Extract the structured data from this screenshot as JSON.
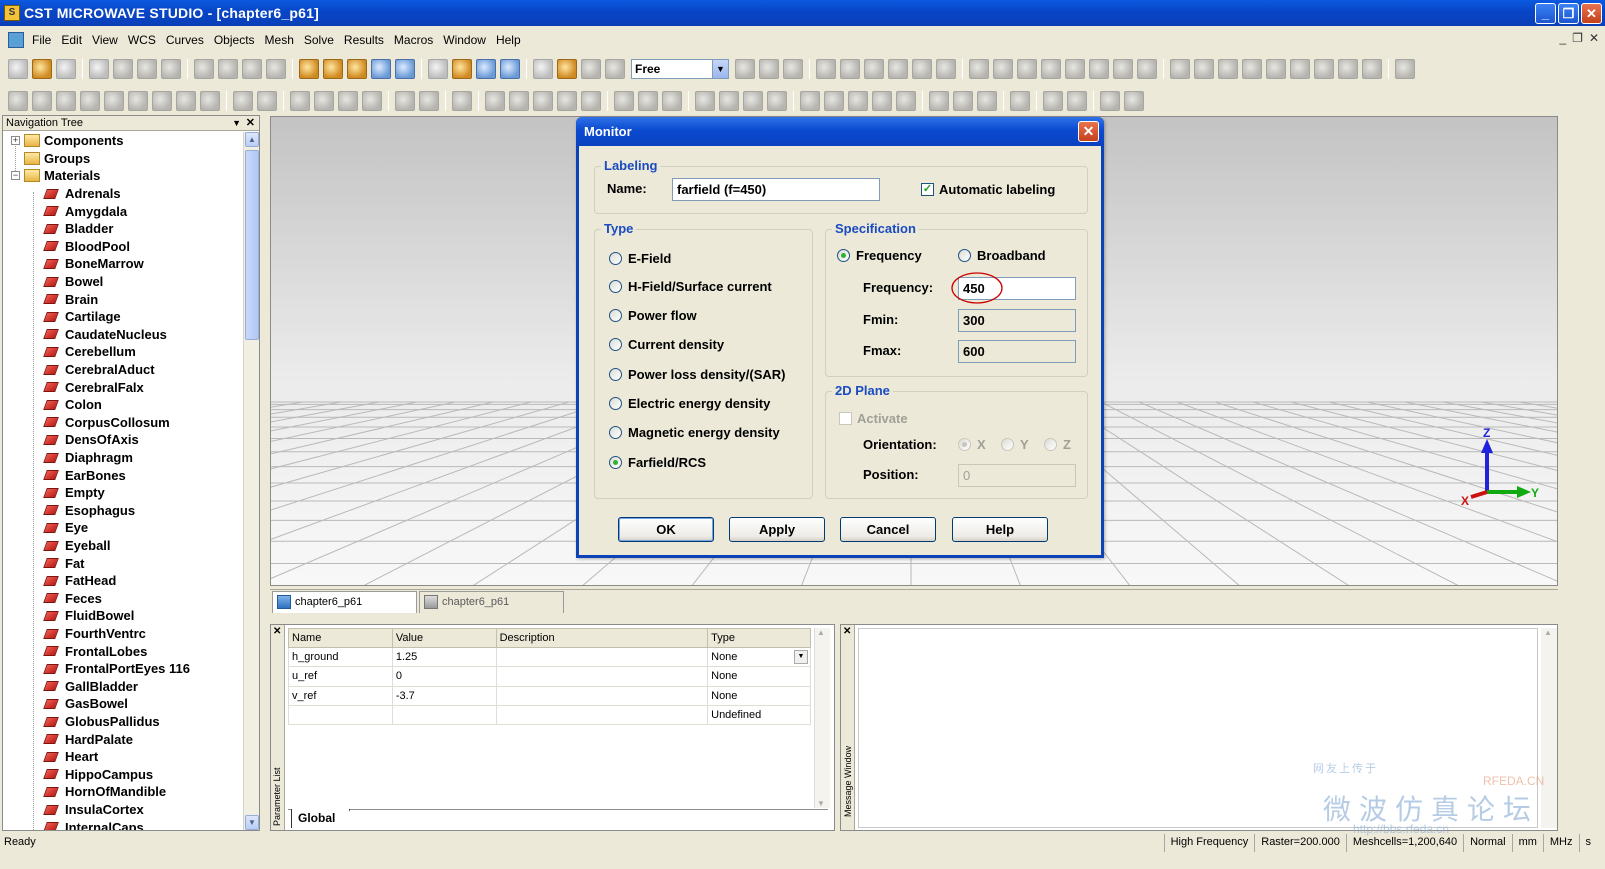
{
  "window": {
    "title": "CST MICROWAVE STUDIO - [chapter6_p61]",
    "min": "_",
    "max": "❐",
    "close": "✕"
  },
  "menu": [
    "File",
    "Edit",
    "View",
    "WCS",
    "Curves",
    "Objects",
    "Mesh",
    "Solve",
    "Results",
    "Macros",
    "Window",
    "Help"
  ],
  "toolbar": {
    "view_mode": "Free"
  },
  "navigation": {
    "title": "Navigation Tree",
    "folders": [
      "Components",
      "Groups",
      "Materials"
    ],
    "materials": [
      "Adrenals",
      "Amygdala",
      "Bladder",
      "BloodPool",
      "BoneMarrow",
      "Bowel",
      "Brain",
      "Cartilage",
      "CaudateNucleus",
      "Cerebellum",
      "CerebralAduct",
      "CerebralFalx",
      "Colon",
      "CorpusCollosum",
      "DensOfAxis",
      "Diaphragm",
      "EarBones",
      "Empty",
      "Esophagus",
      "Eye",
      "Eyeball",
      "Fat",
      "FatHead",
      "Feces",
      "FluidBowel",
      "FourthVentrc",
      "FrontalLobes",
      "FrontalPortEyes 116",
      "GallBladder",
      "GasBowel",
      "GlobusPallidus",
      "HardPalate",
      "Heart",
      "HippoCampus",
      "HornOfMandible",
      "InsulaCortex",
      "InternalCaps"
    ]
  },
  "axes": {
    "z": "Z",
    "y": "Y",
    "x": "X"
  },
  "doc_tabs": [
    "chapter6_p61",
    "chapter6_p61"
  ],
  "parameters": {
    "panel_label": "Parameter List",
    "columns": [
      "Name",
      "Value",
      "Description",
      "Type"
    ],
    "rows": [
      {
        "name": "h_ground",
        "value": "1.25",
        "description": "",
        "type": "None"
      },
      {
        "name": "u_ref",
        "value": "0",
        "description": "",
        "type": "None"
      },
      {
        "name": "v_ref",
        "value": "-3.7",
        "description": "",
        "type": "None"
      },
      {
        "name": "",
        "value": "",
        "description": "",
        "type": "Undefined"
      }
    ],
    "tab": "Global"
  },
  "messages": {
    "panel_label": "Message Window"
  },
  "watermark": {
    "line1": "网友上传于",
    "line2": "微波仿真论坛",
    "line3": "RFEDA.CN",
    "url": "http://bbs.rfeda.cn"
  },
  "status": {
    "ready": "Ready",
    "cells": [
      "High Frequency",
      "Raster=200.000",
      "Meshcells=1,200,640",
      "Normal",
      "mm",
      "MHz",
      "s"
    ]
  },
  "dialog": {
    "title": "Monitor",
    "labeling": {
      "legend": "Labeling",
      "name_label": "Name:",
      "name_value": "farfield (f=450)",
      "auto_label": "Automatic labeling",
      "auto_checked": "✓"
    },
    "type": {
      "legend": "Type",
      "options": [
        "E-Field",
        "H-Field/Surface current",
        "Power flow",
        "Current density",
        "Power loss density/(SAR)",
        "Electric energy density",
        "Magnetic energy density",
        "Farfield/RCS"
      ],
      "selected": "Farfield/RCS"
    },
    "specification": {
      "legend": "Specification",
      "mode_frequency": "Frequency",
      "mode_broadband": "Broadband",
      "frequency_label": "Frequency:",
      "frequency_value": "450",
      "fmin_label": "Fmin:",
      "fmin_value": "300",
      "fmax_label": "Fmax:",
      "fmax_value": "600"
    },
    "plane": {
      "legend": "2D Plane",
      "activate": "Activate",
      "orientation_label": "Orientation:",
      "orient_x": "X",
      "orient_y": "Y",
      "orient_z": "Z",
      "position_label": "Position:",
      "position_value": "0"
    },
    "buttons": {
      "ok": "OK",
      "apply": "Apply",
      "cancel": "Cancel",
      "help": "Help"
    }
  },
  "colors": {
    "title_blue": "#0846c8",
    "legend_blue": "#1a4bc0",
    "highlight_red": "#cc0000"
  }
}
